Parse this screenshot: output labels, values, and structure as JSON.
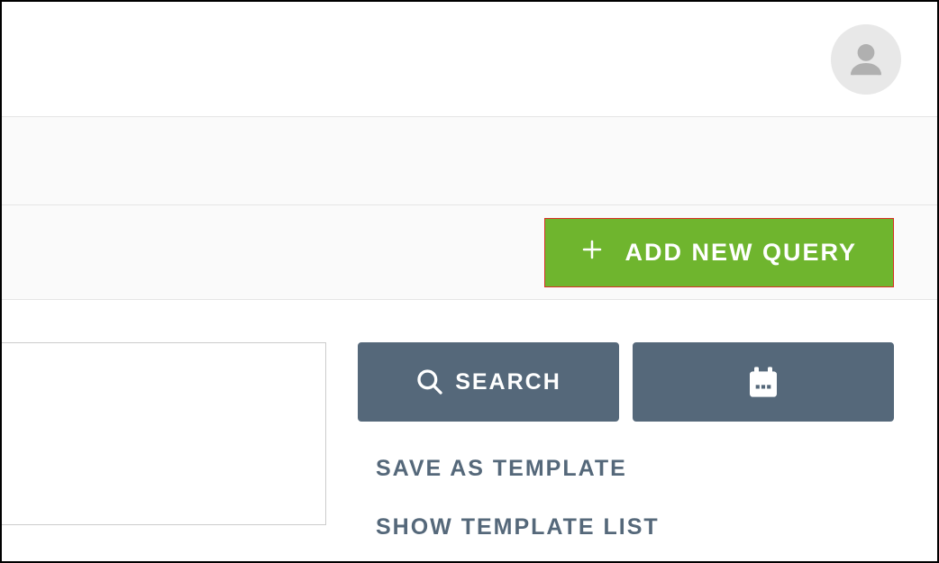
{
  "toolbar": {
    "add_new_query_label": "ADD NEW QUERY"
  },
  "controls": {
    "search_label": "SEARCH",
    "save_template_label": "SAVE AS TEMPLATE",
    "show_template_list_label": "SHOW TEMPLATE LIST"
  }
}
